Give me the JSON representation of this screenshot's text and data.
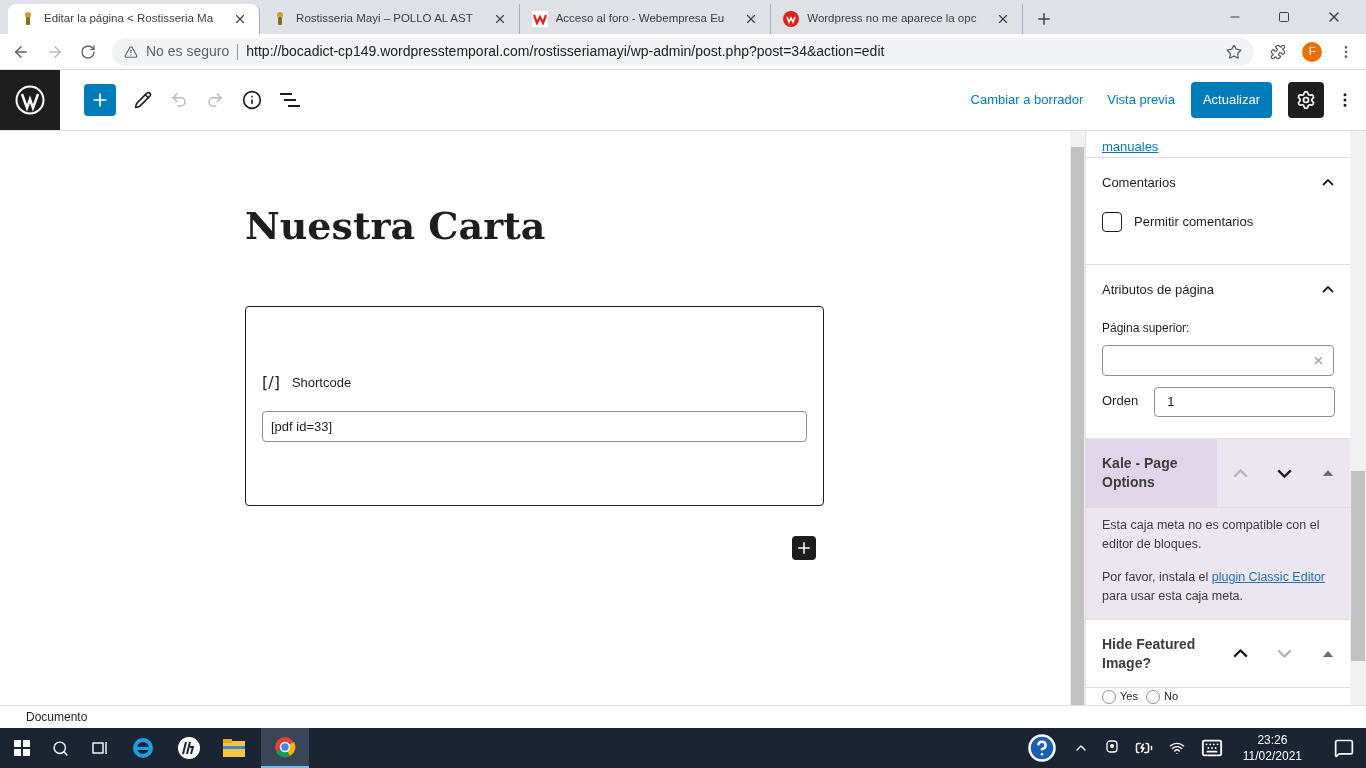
{
  "browser": {
    "tabs": [
      {
        "title": "Editar la página < Rostisseria Ma",
        "selected": true,
        "kind": "chef"
      },
      {
        "title": "Rostisseria Mayi – POLLO AL AST",
        "selected": false,
        "kind": "chef"
      },
      {
        "title": "Acceso al foro - Webempresa Eu",
        "selected": false,
        "kind": "square"
      },
      {
        "title": "Wordpress no me aparece la opc",
        "selected": false,
        "kind": "circle"
      }
    ],
    "security": "No es seguro",
    "url": "http://bocadict-cp149.wordpresstemporal.com/rostisseriamayi/wp-admin/post.php?post=34&action=edit",
    "avatar": "F"
  },
  "toolbar": {
    "undo_disabled": true,
    "redo_disabled": true,
    "draft_link": "Cambiar a borrador",
    "preview_link": "Vista previa",
    "update_button": "Actualizar",
    "settings_selected": true
  },
  "editor": {
    "title": "Nuestra Carta",
    "block": {
      "icon": "[/]",
      "label": "Shortcode",
      "value": "[pdf id=33]"
    }
  },
  "sidebar": {
    "top_link": "manuales",
    "comments": {
      "title": "Comentarios",
      "expanded": true,
      "checkbox": {
        "label": "Permitir comentarios",
        "checked": false
      }
    },
    "attributes": {
      "title": "Atributos de página",
      "expanded": true,
      "parent_label": "Página superior:",
      "order_label": "Orden",
      "order_value": "1"
    },
    "metaboxes": [
      {
        "title": "Kale - Page Options",
        "highlighted": true,
        "up_disabled": true,
        "down_disabled": false,
        "notice": "Esta caja meta no es compatible con el editor de bloques.",
        "help_before": "Por favor, instala el ",
        "help_link": "plugin Classic Editor",
        "help_after": " para usar esta caja meta."
      },
      {
        "title": "Hide Featured Image?",
        "highlighted": false,
        "up_disabled": false,
        "down_disabled": true,
        "radios": [
          {
            "label": "Yes",
            "selected": false
          },
          {
            "label": "No",
            "selected": false
          }
        ]
      }
    ]
  },
  "status_bar": "Documento",
  "taskbar": {
    "time": "23:26",
    "date": "11/02/2021"
  }
}
